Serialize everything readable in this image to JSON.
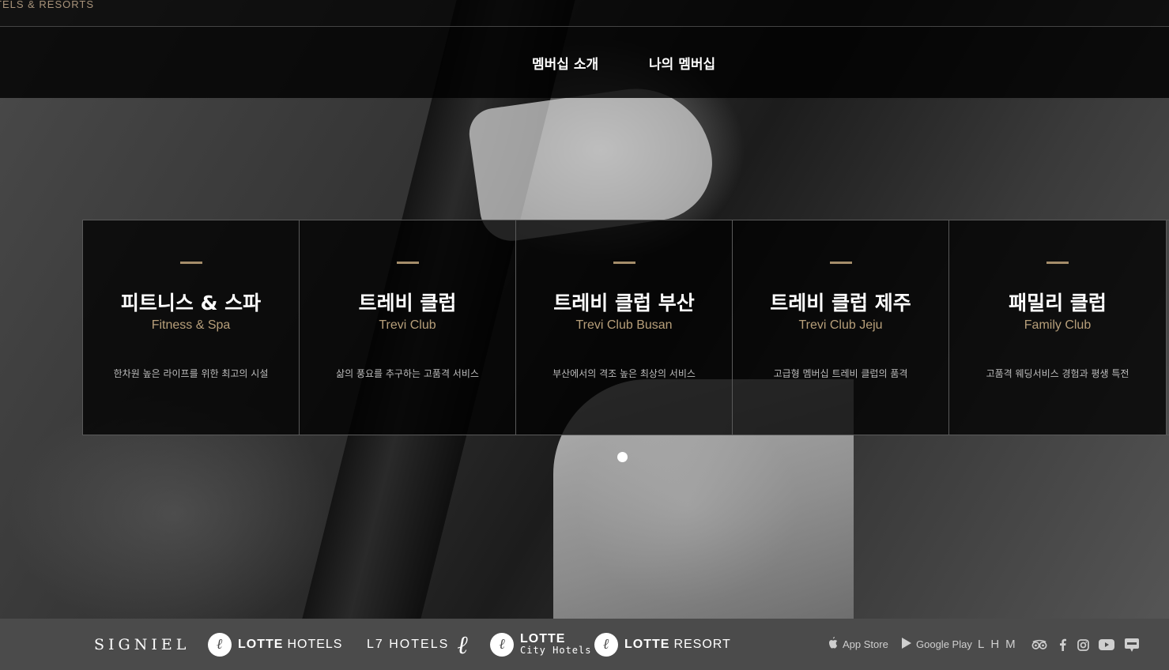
{
  "topbar": {
    "brand": "TELS & RESORTS"
  },
  "subnav": {
    "tabs": [
      "멤버십 소개",
      "나의 멤버십"
    ]
  },
  "cards": [
    {
      "title": "피트니스 & 스파",
      "subtitle": "Fitness & Spa",
      "desc": "한차원 높은 라이프를 위한 최고의 시설"
    },
    {
      "title": "트레비 클럽",
      "subtitle": "Trevi Club",
      "desc": "삶의 풍요를 추구하는 고품격 서비스"
    },
    {
      "title": "트레비 클럽 부산",
      "subtitle": "Trevi Club Busan",
      "desc": "부산에서의 격조 높은 최상의 서비스"
    },
    {
      "title": "트레비 클럽 제주",
      "subtitle": "Trevi Club Jeju",
      "desc": "고급형 멤버십 트레비 클럽의 품격"
    },
    {
      "title": "패밀리 클럽",
      "subtitle": "Family Club",
      "desc": "고품격 웨딩서비스 경험과 평생 특전"
    }
  ],
  "footer": {
    "logos": {
      "signiel": "SIGNIEL",
      "lotte_hotels_bold": "LOTTE",
      "lotte_hotels_rest": "HOTELS",
      "l7": "L7 HOTELS",
      "l7_script": "ℓ",
      "lotte_city_top": "LOTTE",
      "lotte_city_bottom": "City Hotels",
      "lotte_resort_bold": "LOTTE",
      "lotte_resort_rest": "RESORT",
      "circle_glyph": "ℓ"
    },
    "stores": {
      "apple": "App Store",
      "google": "Google Play"
    },
    "lhm": "LHM",
    "social_icons": [
      "tripadvisor-icon",
      "facebook-icon",
      "instagram-icon",
      "youtube-icon",
      "blog-icon"
    ]
  },
  "colors": {
    "accent_gold": "#b79f7a",
    "bar_gold": "#a58d6a",
    "footer_bg": "#4b4b4b"
  }
}
